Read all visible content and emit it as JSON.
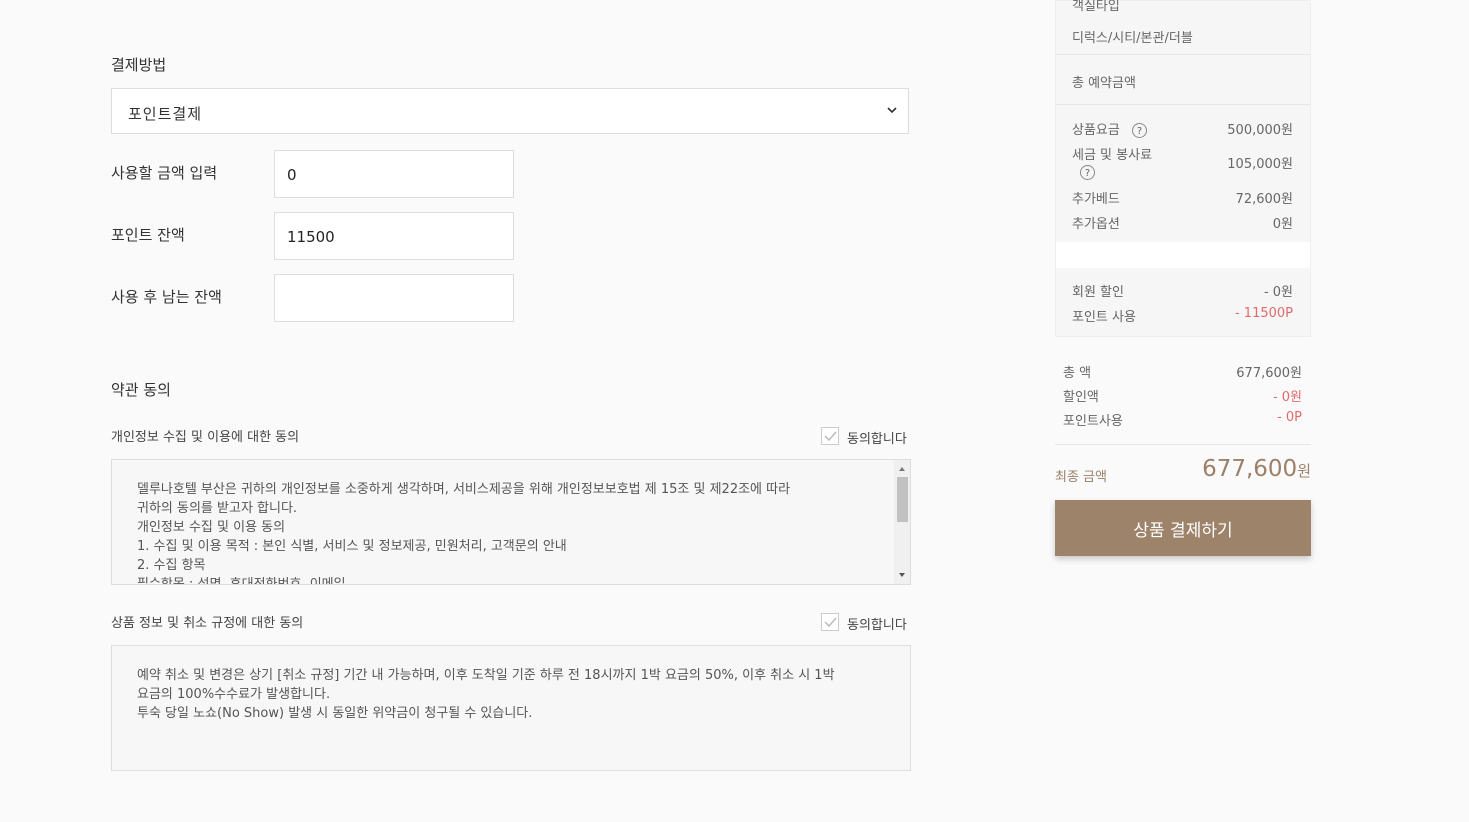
{
  "payment": {
    "section_title": "결제방법",
    "method_selected": "포인트결제",
    "use_amount_label": "사용할 금액 입력",
    "use_amount_value": "0",
    "point_balance_label": "포인트 잔액",
    "point_balance_value": "11500",
    "remaining_label": "사용 후 남는 잔액",
    "remaining_value": ""
  },
  "terms": {
    "section_title": "약관 동의",
    "privacy": {
      "title": "개인정보 수집 및 이용에 대한 동의",
      "agree_label": "동의합니다",
      "lines": [
        "델루나호텔 부산은 귀하의 개인정보를 소중하게 생각하며, 서비스제공을 위해 개인정보보호법 제 15조 및 제22조에 따라",
        "귀하의 동의를 받고자 합니다.",
        "개인정보 수집 및 이용 동의",
        "1. 수집 및 이용 목적 : 본인 식별, 서비스 및 정보제공, 민원처리, 고객문의 안내",
        "2. 수집 항목",
        "필수항목 : 성명, 휴대전화번호, 이메일"
      ]
    },
    "cancel": {
      "title": "상품 정보 및 취소 규정에 대한 동의",
      "agree_label": "동의합니다",
      "lines": [
        "예약 취소 및 변경은 상기 [취소 규정] 기간 내 가능하며, 이후 도착일 기준 하루 전 18시까지 1박 요금의 50%, 이후 취소 시 1박",
        "요금의 100%수수료가 발생합니다.",
        "투숙 당일 노쇼(No Show) 발생 시 동일한 위약금이 청구될 수 있습니다."
      ]
    }
  },
  "summary": {
    "room_type_label": "객실타입",
    "room_type_value": "디럭스/시티/본관/더블",
    "total_reserve_label": "총 예약금액",
    "product_fee_label": "상품요금",
    "product_fee_value": "500,000원",
    "tax_label": "세금 및 봉사료",
    "tax_value": "105,000원",
    "extra_bed_label": "추가베드",
    "extra_bed_value": "72,600원",
    "extra_option_label": "추가옵션",
    "extra_option_value": "0원",
    "member_discount_label": "회원 할인",
    "member_discount_value": "- 0원",
    "point_use_label": "포인트 사용",
    "point_use_value": "- 11500P",
    "total_label": "총 액",
    "total_value": "677,600원",
    "discount_label": "할인액",
    "discount_value": "- 0원",
    "point_label": "포인트사용",
    "point_value": "- 0P",
    "final_label": "최종 금액",
    "final_value": "677,600",
    "final_unit": "원",
    "pay_button": "상품 결제하기",
    "help_symbol": "?"
  },
  "colors": {
    "accent": "#9e836b",
    "discount_red": "#e06a6a"
  }
}
